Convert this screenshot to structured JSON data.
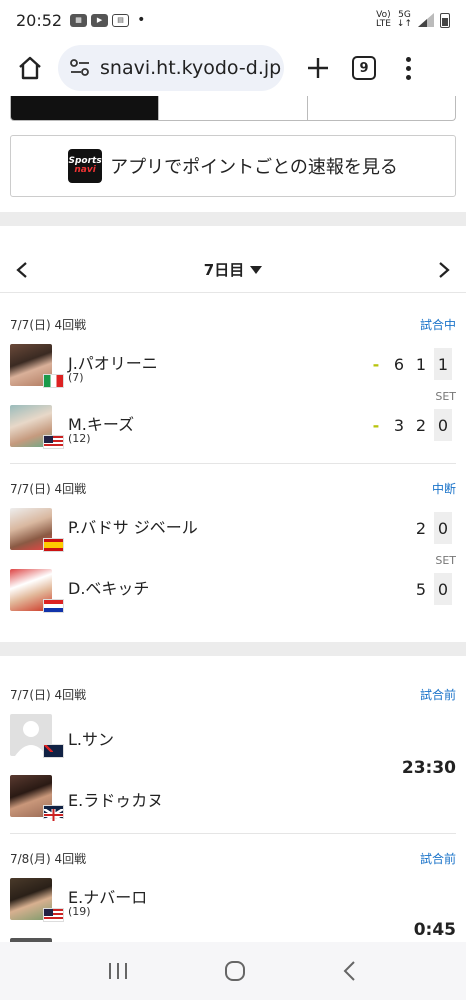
{
  "status_bar": {
    "time": "20:52",
    "network": "5G",
    "carrier": "Vo) LTE"
  },
  "browser": {
    "url": "snavi.ht.kyodo-d.jp",
    "tab_count": "9"
  },
  "app_banner": {
    "logo_line1": "Sports",
    "logo_line2": "navi",
    "text": "アプリでポイントごとの速報を見る"
  },
  "day_nav": {
    "label": "7日目"
  },
  "matches": [
    {
      "header": "7/7(日) 4回戦",
      "status": "試合中",
      "status_color": "#1a73c9",
      "players": [
        {
          "name": "J.パオリーニ",
          "seed": "(7)",
          "flag": "Italy",
          "scores": [
            "6",
            "1"
          ],
          "current": "1",
          "serving": true
        },
        {
          "name": "M.キーズ",
          "seed": "(12)",
          "flag": "USA",
          "scores": [
            "3",
            "2"
          ],
          "current": "0",
          "serving": true
        }
      ],
      "set_label": "SET"
    },
    {
      "header": "7/7(日) 4回戦",
      "status": "中断",
      "status_color": "#1a73c9",
      "players": [
        {
          "name": "P.バドサ ジベール",
          "seed": "",
          "flag": "Spain",
          "scores": [
            "2"
          ],
          "current": "0"
        },
        {
          "name": "D.ベキッチ",
          "seed": "",
          "flag": "Croatia",
          "scores": [
            "5"
          ],
          "current": "0"
        }
      ],
      "set_label": "SET"
    },
    {
      "header": "7/7(日) 4回戦",
      "status": "試合前",
      "status_color": "#1a73c9",
      "players": [
        {
          "name": "L.サン",
          "seed": "",
          "flag": "New Zealand"
        },
        {
          "name": "E.ラドゥカヌ",
          "seed": "",
          "flag": "UK"
        }
      ],
      "start_time": "23:30"
    },
    {
      "header": "7/8(月) 4回戦",
      "status": "試合前",
      "status_color": "#1a73c9",
      "players": [
        {
          "name": "E.ナバーロ",
          "seed": "(19)",
          "flag": "USA"
        }
      ],
      "start_time": "0:45"
    }
  ]
}
